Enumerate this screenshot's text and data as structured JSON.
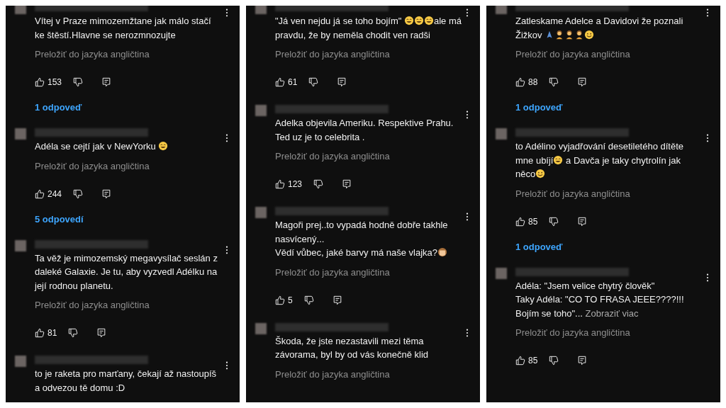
{
  "panels": [
    {
      "comments": [
        {
          "body": [
            {
              "kind": "text",
              "text": "Vítej v Praze mimozemžtane jak málo stačí ke štěstí.Hlavne se nerozmnozujte"
            }
          ],
          "translate": "Preložiť do jazyka angličtina",
          "likes": "153",
          "replies": "1 odpoveď"
        },
        {
          "body": [
            {
              "kind": "text",
              "text": "Adéla se cejtí jak v NewYorku "
            },
            {
              "kind": "emoji_laugh"
            }
          ],
          "translate": "Preložiť do jazyka angličtina",
          "likes": "244",
          "replies": "5 odpovedí"
        },
        {
          "body": [
            {
              "kind": "text",
              "text": "Ta věž je mimozemský megavysílač seslán z daleké Galaxie. Je tu, aby vyzvedl Adélku na její rodnou planetu."
            }
          ],
          "translate": "Preložiť do jazyka angličtina",
          "likes": "81"
        },
        {
          "body": [
            {
              "kind": "text",
              "text": "to je raketa pro marťany, čekají až nastoupíš a odvezou tě domu :D"
            }
          ]
        }
      ]
    },
    {
      "comments": [
        {
          "body": [
            {
              "kind": "text",
              "text": "\"Já ven nejdu já se toho bojím\" "
            },
            {
              "kind": "emoji_grin"
            },
            {
              "kind": "emoji_grin"
            },
            {
              "kind": "emoji_grin"
            },
            {
              "kind": "text",
              "text": "ale má pravdu, že by neměla chodit ven radši"
            }
          ],
          "translate": "Preložiť do jazyka angličtina",
          "likes": "61"
        },
        {
          "body": [
            {
              "kind": "text",
              "text": "Adelka objevila Ameriku. Respektive Prahu. Ted uz je to celebrita ."
            }
          ],
          "translate": "Preložiť do jazyka angličtina",
          "likes": "123"
        },
        {
          "body": [
            {
              "kind": "text",
              "text": "Magoři prej..to vypadá hodně dobře takhle nasvícený...\nVědí vůbec, jaké barvy má naše vlajka?"
            },
            {
              "kind": "emoji_monkey"
            }
          ],
          "translate": "Preložiť do jazyka angličtina",
          "likes": "5"
        },
        {
          "body": [
            {
              "kind": "text",
              "text": "Škoda, že jste nezastavili mezi těma závorama, byl by od vás konečně klid"
            }
          ],
          "translate": "Preložiť do jazyka angličtina"
        }
      ]
    },
    {
      "comments": [
        {
          "body": [
            {
              "kind": "text",
              "text": "Zatleskame Adelce a Davidovi že poznali Žižkov "
            },
            {
              "kind": "emoji_pray"
            },
            {
              "kind": "emoji_person"
            },
            {
              "kind": "emoji_person"
            },
            {
              "kind": "emoji_person"
            },
            {
              "kind": "emoji_smile"
            }
          ],
          "translate": "Preložiť do jazyka angličtina",
          "likes": "88",
          "replies": "1 odpoveď"
        },
        {
          "body": [
            {
              "kind": "text",
              "text": "to Adélino vyjadřování desetiletého dítěte mne ubíjí"
            },
            {
              "kind": "emoji_grin"
            },
            {
              "kind": "text",
              "text": " a Davča je taky chytrolín jak něco"
            },
            {
              "kind": "emoji_smile"
            }
          ],
          "translate": "Preložiť do jazyka angličtina",
          "likes": "85",
          "replies": "1 odpoveď"
        },
        {
          "body": [
            {
              "kind": "text",
              "text": "Adéla: \"Jsem velice chytrý člověk\"\nTaky Adéla: \"CO TO FRASA JEEE????!!! Bojím se toho\"... "
            },
            {
              "kind": "more",
              "text": "Zobraziť viac"
            }
          ],
          "translate": "Preložiť do jazyka angličtina",
          "likes": "85"
        }
      ]
    }
  ]
}
